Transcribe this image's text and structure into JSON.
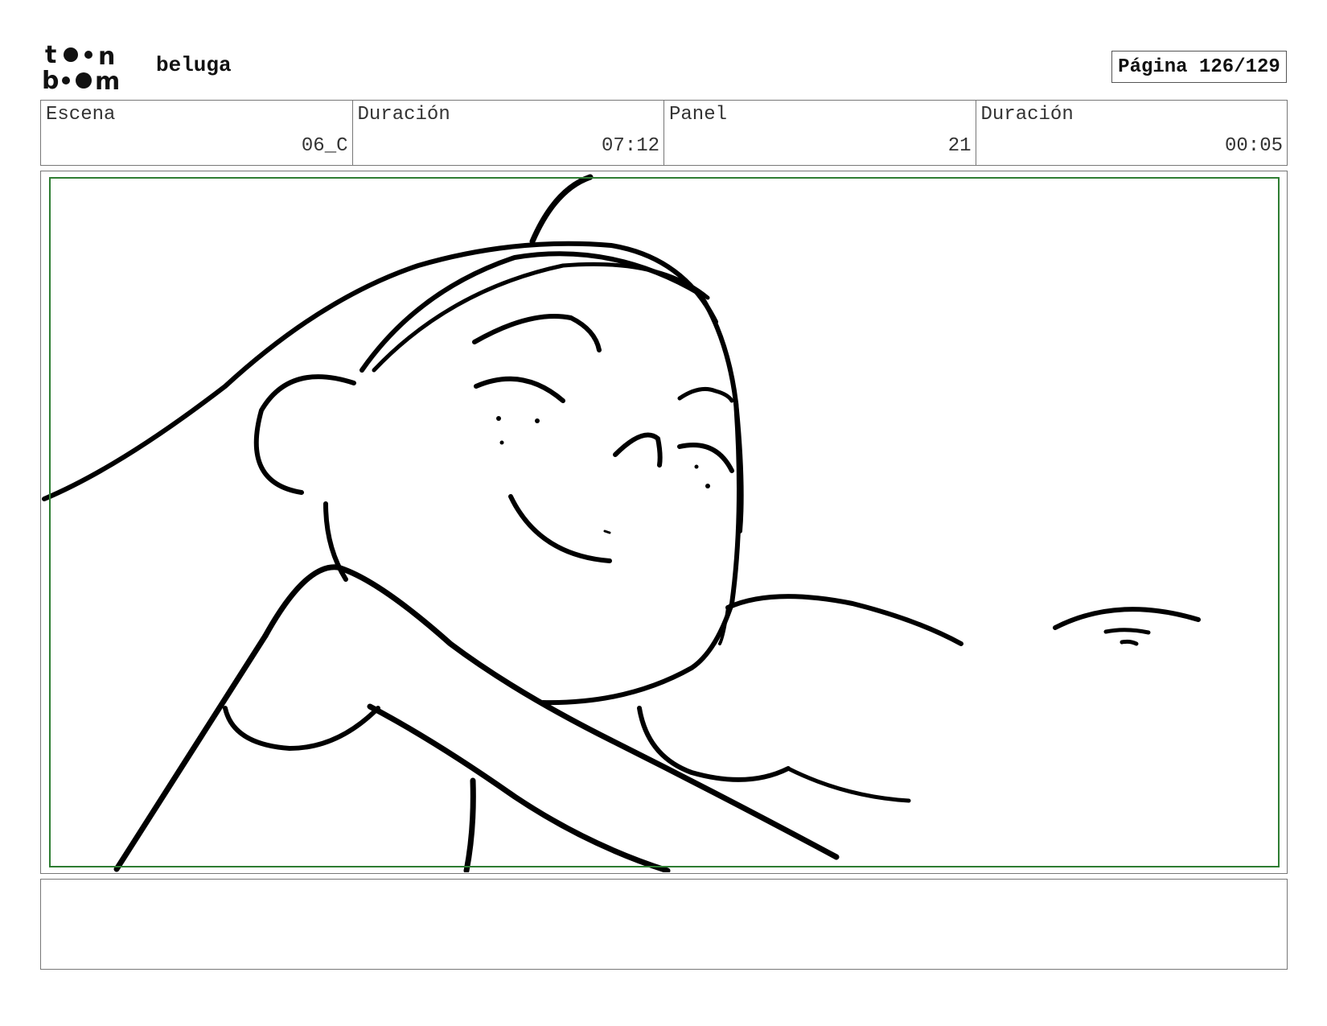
{
  "header": {
    "logo_text": "toon boom",
    "project": "beluga",
    "page": "Página 126/129"
  },
  "info": {
    "scene_label": "Escena",
    "scene_value": "06_C",
    "scene_duration_label": "Duración",
    "scene_duration_value": "07:12",
    "panel_label": "Panel",
    "panel_value": "21",
    "panel_duration_label": "Duración",
    "panel_duration_value": "00:05"
  },
  "notes": {
    "text": ""
  }
}
